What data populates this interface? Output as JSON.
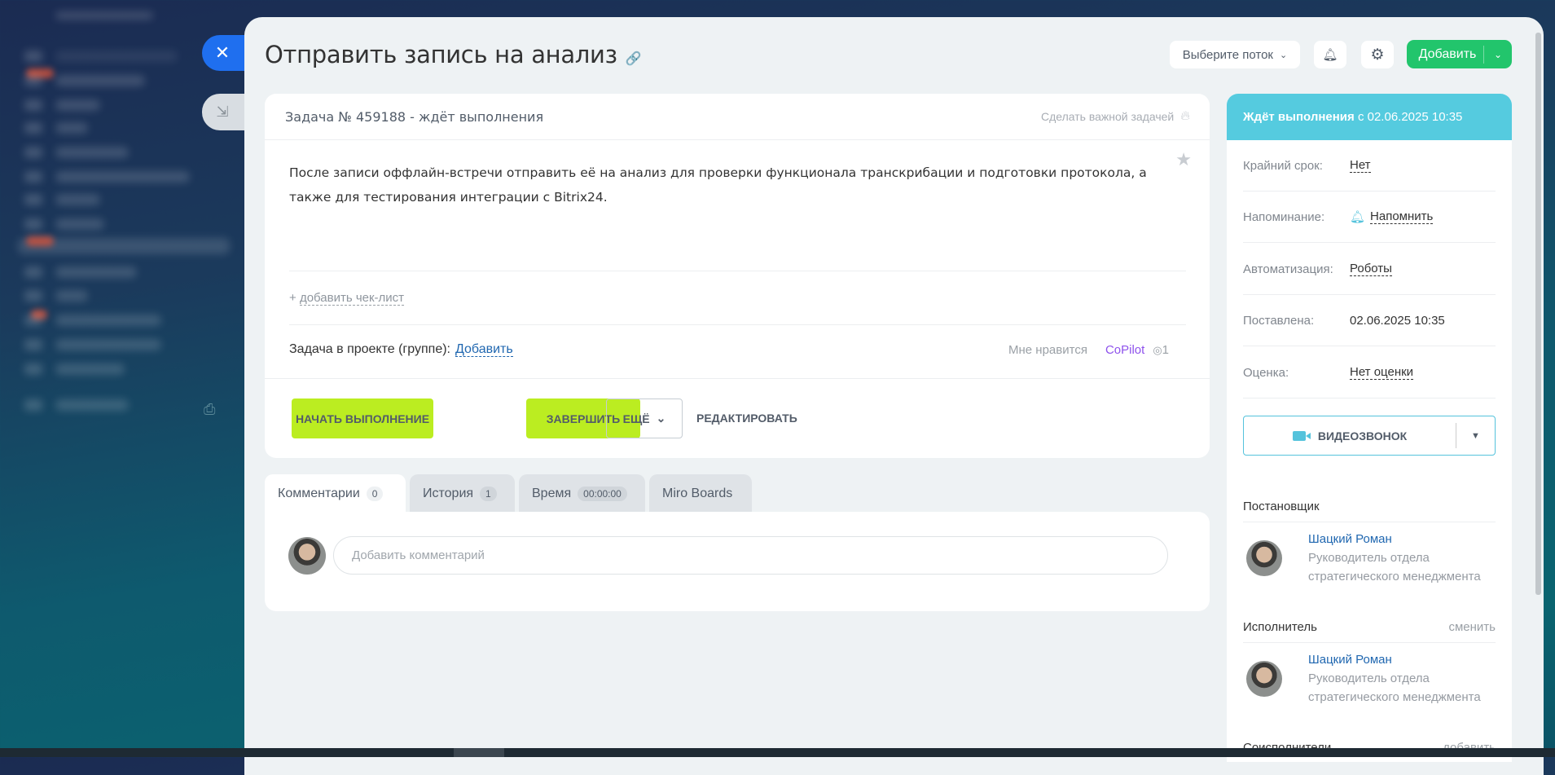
{
  "window": {
    "close_icon": "close-icon",
    "minimize_icon": "collapse-icon"
  },
  "header": {
    "title": "Отправить запись на анализ",
    "stream_select": "Выберите поток",
    "add_button": "Добавить"
  },
  "task": {
    "heading": "Задача № 459188 - ждёт выполнения",
    "make_important": "Сделать важной задачей",
    "description": "После записи оффлайн-встречи отправить её на анализ для проверки функционала транскрибации и подготовки протокола, а также для тестирования интеграции с Bitrix24.",
    "add_checklist_plus": "+",
    "add_checklist": "добавить чек-лист",
    "project_label": "Задача в проекте (группе):",
    "project_add": "Добавить",
    "like": "Мне нравится",
    "copilot": "CoPilot",
    "views": "1",
    "actions": {
      "start": "НАЧАТЬ ВЫПОЛНЕНИЕ",
      "finish": "ЗАВЕРШИТЬ",
      "more": "ЕЩЁ",
      "edit": "РЕДАКТИРОВАТЬ"
    }
  },
  "tabs": [
    {
      "label": "Комментарии",
      "count": "0"
    },
    {
      "label": "История",
      "count": "1"
    },
    {
      "label": "Время",
      "count": "00:00:00"
    },
    {
      "label": "Miro Boards"
    }
  ],
  "comments": {
    "placeholder": "Добавить комментарий"
  },
  "sidebar": {
    "status_bold": "Ждёт выполнения",
    "status_rest": "с 02.06.2025 10:35",
    "status_color": "#55cbdf",
    "rows": [
      {
        "label": "Крайний срок:",
        "value": "Нет"
      },
      {
        "label": "Напоминание:",
        "value": "Напомнить"
      },
      {
        "label": "Автоматизация:",
        "value": "Роботы"
      },
      {
        "label": "Поставлена:",
        "value": "02.06.2025 10:35"
      },
      {
        "label": "Оценка:",
        "value": "Нет оценки"
      }
    ],
    "video_call": "ВИДЕОЗВОНОК",
    "creator_title": "Постановщик",
    "creator": {
      "name": "Шацкий Роман",
      "role": "Руководитель отдела стратегического менеджмента"
    },
    "responsible_title": "Исполнитель",
    "responsible_change": "сменить",
    "responsible": {
      "name": "Шацкий Роман",
      "role": "Руководитель отдела стратегического менеджмента"
    },
    "accomplices_title": "Соисполнители",
    "accomplices_add": "добавить"
  },
  "colors": {
    "accent_green": "#22c56c",
    "action_lime": "#bbed21",
    "close_blue": "#1f6fef"
  }
}
